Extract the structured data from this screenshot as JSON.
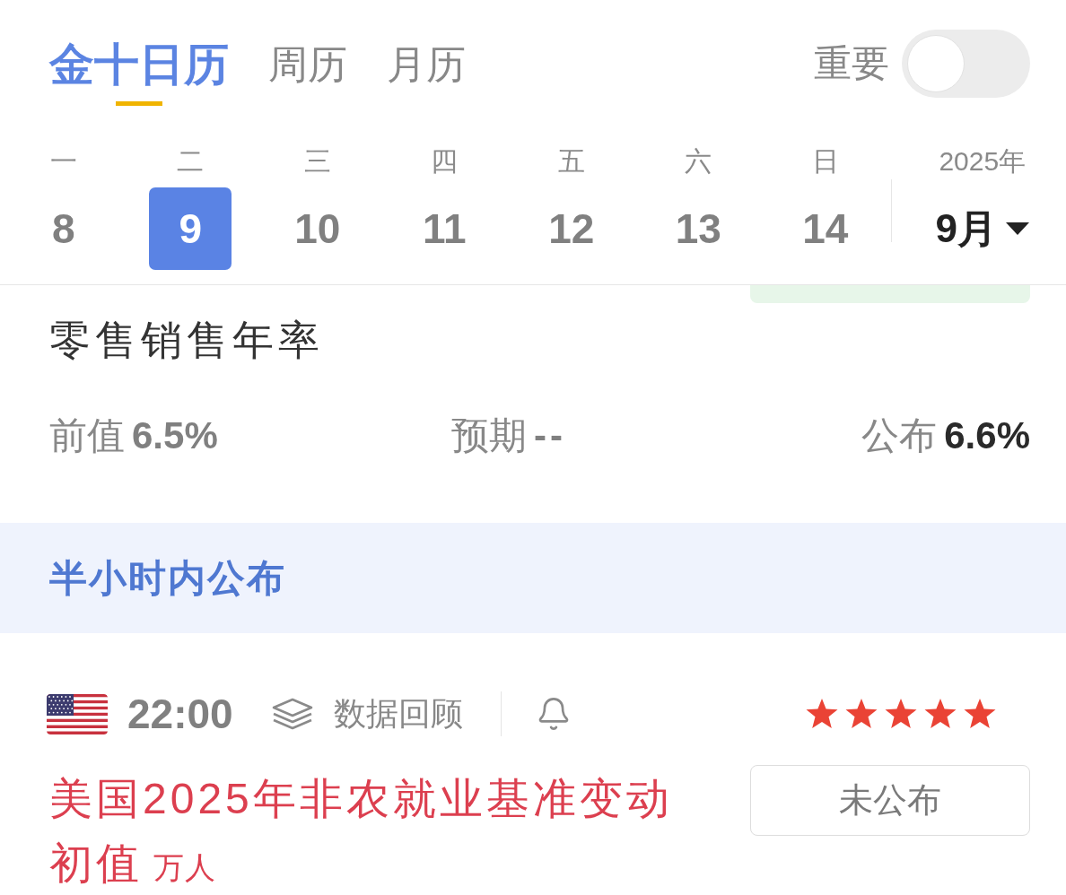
{
  "tabs": [
    {
      "label": "金十日历",
      "selected": true
    },
    {
      "label": "周历",
      "selected": false
    },
    {
      "label": "月历",
      "selected": false
    }
  ],
  "important_toggle": {
    "label": "重要",
    "on": false
  },
  "week": {
    "days": [
      {
        "weekday": "一",
        "date": "8",
        "selected": false
      },
      {
        "weekday": "二",
        "date": "9",
        "selected": true
      },
      {
        "weekday": "三",
        "date": "10",
        "selected": false
      },
      {
        "weekday": "四",
        "date": "11",
        "selected": false
      },
      {
        "weekday": "五",
        "date": "12",
        "selected": false
      },
      {
        "weekday": "六",
        "date": "13",
        "selected": false
      },
      {
        "weekday": "日",
        "date": "14",
        "selected": false
      }
    ],
    "year": "2025年",
    "month": "9月"
  },
  "previous_event": {
    "title": "零售销售年率",
    "previous_label": "前值",
    "previous": "6.5%",
    "forecast_label": "预期",
    "forecast": "--",
    "actual_label": "公布",
    "actual": "6.6%"
  },
  "section": {
    "title": "半小时内公布"
  },
  "events": [
    {
      "time": "22:00",
      "review_label": "数据回顾",
      "stars": 5,
      "title": "美国2025年非农就业基准变动初值",
      "unit": "万人",
      "status": "未公布"
    }
  ]
}
